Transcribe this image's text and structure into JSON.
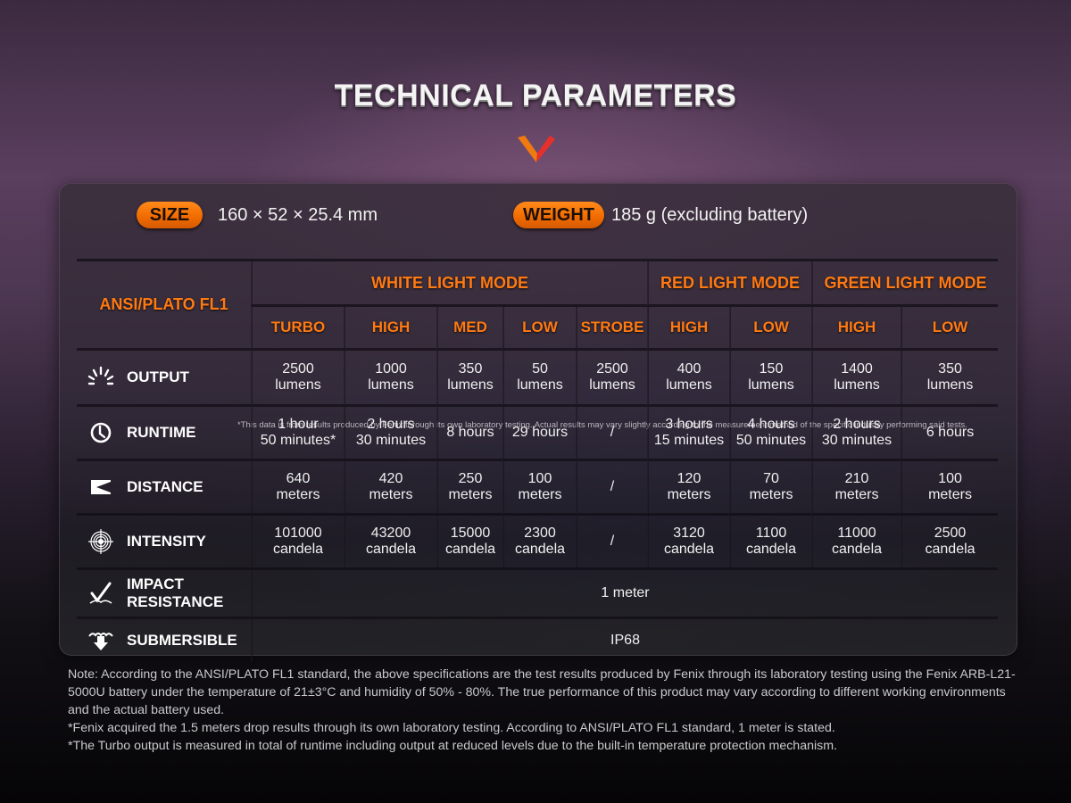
{
  "title": "TECHNICAL PARAMETERS",
  "colors": {
    "accent": "#ff7a12",
    "pill": "#f06a00",
    "chevron_left": "#f07a10",
    "chevron_right": "#e8302a"
  },
  "specs": {
    "size_label": "SIZE",
    "size_value": "160 × 52 ×  25.4 mm",
    "weight_label": "WEIGHT",
    "weight_value": "185 g (excluding battery)",
    "disclaimer": "*This data is from results produced by Fenix through its own laboratory testing. Actual results may vary slightly according to the measurement method of the specific industry performing said tests."
  },
  "table": {
    "standard": "ANSI/PLATO FL1",
    "groups": [
      "WHITE LIGHT MODE",
      "RED LIGHT MODE",
      "GREEN LIGHT MODE"
    ],
    "modes": [
      "TURBO",
      "HIGH",
      "MED",
      "LOW",
      "STROBE",
      "HIGH",
      "LOW",
      "HIGH",
      "LOW"
    ],
    "rows": [
      {
        "label": "OUTPUT",
        "icon": "output-icon",
        "cells": [
          [
            "2500",
            "lumens"
          ],
          [
            "1000",
            "lumens"
          ],
          [
            "350",
            "lumens"
          ],
          [
            "50",
            "lumens"
          ],
          [
            "2500",
            "lumens"
          ],
          [
            "400",
            "lumens"
          ],
          [
            "150",
            "lumens"
          ],
          [
            "1400",
            "lumens"
          ],
          [
            "350",
            "lumens"
          ]
        ]
      },
      {
        "label": "RUNTIME",
        "icon": "clock-icon",
        "cells": [
          [
            "1 hour",
            "50 minutes*"
          ],
          [
            "2 hours",
            "30 minutes"
          ],
          [
            "8 hours",
            ""
          ],
          [
            "29 hours",
            ""
          ],
          [
            "/",
            ""
          ],
          [
            "3 hours",
            "15 minutes"
          ],
          [
            "4 hours",
            "50 minutes"
          ],
          [
            "2 hours",
            "30 minutes"
          ],
          [
            "6 hours",
            ""
          ]
        ]
      },
      {
        "label": "DISTANCE",
        "icon": "distance-icon",
        "cells": [
          [
            "640",
            "meters"
          ],
          [
            "420",
            "meters"
          ],
          [
            "250",
            "meters"
          ],
          [
            "100",
            "meters"
          ],
          [
            "/",
            ""
          ],
          [
            "120",
            "meters"
          ],
          [
            "70",
            "meters"
          ],
          [
            "210",
            "meters"
          ],
          [
            "100",
            "meters"
          ]
        ]
      },
      {
        "label": "INTENSITY",
        "icon": "target-icon",
        "cells": [
          [
            "101000",
            "candela"
          ],
          [
            "43200",
            "candela"
          ],
          [
            "15000",
            "candela"
          ],
          [
            "2300",
            "candela"
          ],
          [
            "/",
            ""
          ],
          [
            "3120",
            "candela"
          ],
          [
            "1100",
            "candela"
          ],
          [
            "11000",
            "candela"
          ],
          [
            "2500",
            "candela"
          ]
        ]
      }
    ],
    "impact": {
      "label_line1": "IMPACT",
      "label_line2": "RESISTANCE",
      "value": "1 meter"
    },
    "submersible": {
      "label": "SUBMERSIBLE",
      "value": "IP68"
    }
  },
  "notes": [
    "Note: According to the ANSI/PLATO FL1 standard, the above specifications are the test results produced by Fenix through its laboratory testing using the Fenix ARB-L21-5000U battery under the temperature of 21±3°C and humidity of 50% - 80%. The true performance of this product may vary according to different working environments and the actual battery used.",
    "*Fenix acquired the 1.5 meters drop results through its own laboratory testing. According to ANSI/PLATO FL1 standard, 1 meter is stated.",
    "*The Turbo output is measured in total of runtime including output at reduced levels due to the built-in temperature protection mechanism."
  ]
}
